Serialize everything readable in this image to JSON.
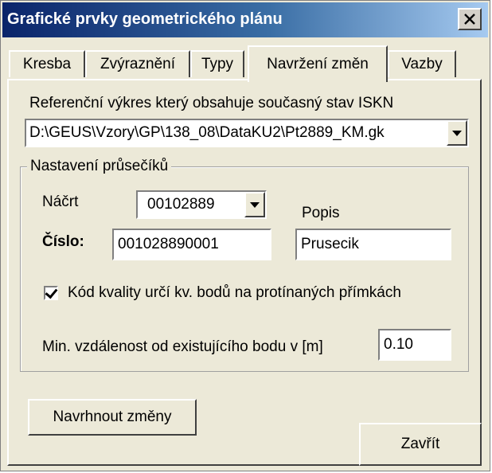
{
  "window": {
    "title": "Grafické prvky geometrického plánu",
    "close_glyph": "✕"
  },
  "tabs": [
    {
      "label": "Kresba",
      "active": false
    },
    {
      "label": "Zvýraznění",
      "active": false
    },
    {
      "label": "Typy",
      "active": false
    },
    {
      "label": "Navržení změn",
      "active": true
    },
    {
      "label": "Vazby",
      "active": false
    }
  ],
  "reference": {
    "label": "Referenční výkres který obsahuje současný stav ISKN",
    "path": "D:\\GEUS\\Vzory\\GP\\138_08\\DataKU2\\Pt2889_KM.gk"
  },
  "intersections": {
    "legend": "Nastavení průsečíků",
    "sketch_label": "Náčrt",
    "sketch_value": "00102889",
    "description_label": "Popis",
    "number_label": "Číslo:",
    "number_value": "001028890001",
    "description_value": "Prusecik",
    "quality_checkbox_label": "Kód kvality určí kv. bodů na protínaných přímkách",
    "quality_checked": true,
    "min_distance_label": "Min. vzdálenost od existujícího bodu v [m]",
    "min_distance_value": "0.10"
  },
  "buttons": {
    "propose": "Navrhnout změny",
    "close": "Zavřít"
  }
}
